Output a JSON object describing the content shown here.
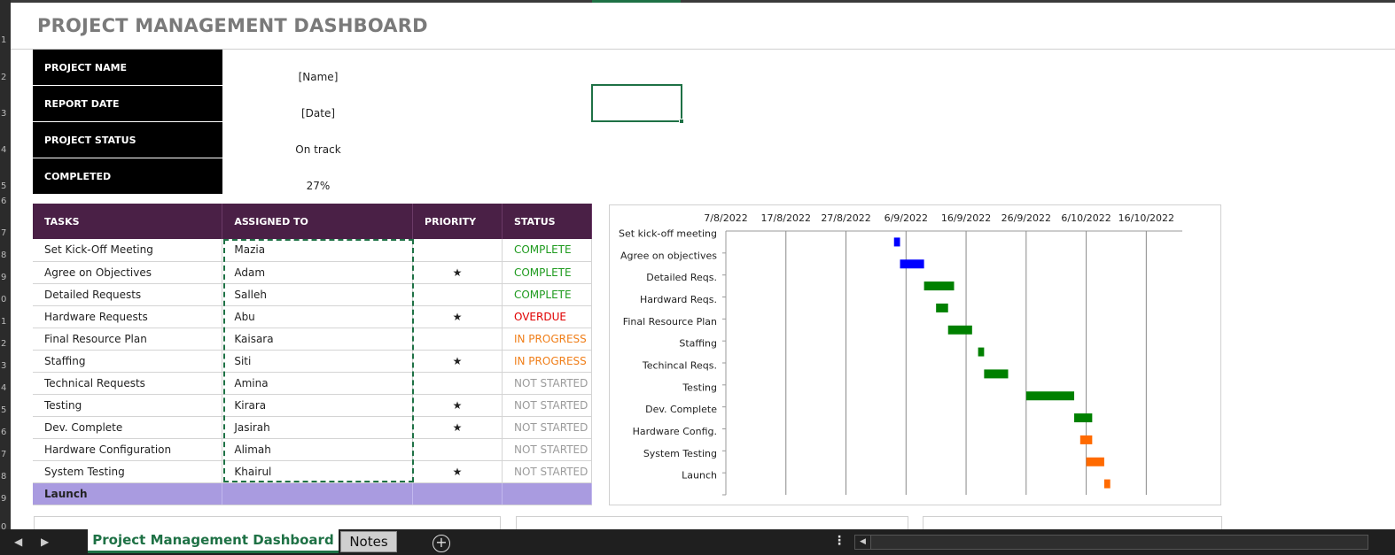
{
  "window": {
    "title": "PROJECT MANAGEMENT DASHBOARD"
  },
  "row_numbers": [
    "1",
    "2",
    "3",
    "4",
    "5",
    "6",
    "7",
    "8",
    "9",
    "0",
    "1",
    "2",
    "3",
    "4",
    "5",
    "6",
    "7",
    "8",
    "9",
    "0"
  ],
  "project_info": [
    {
      "label": "PROJECT NAME",
      "value": "[Name]"
    },
    {
      "label": "REPORT DATE",
      "value": "[Date]"
    },
    {
      "label": "PROJECT STATUS",
      "value": "On track"
    },
    {
      "label": "COMPLETED",
      "value": "27%"
    }
  ],
  "task_table": {
    "headers": [
      "TASKS",
      "ASSIGNED TO",
      "PRIORITY",
      "STATUS"
    ],
    "rows": [
      {
        "task": "Set Kick-Off Meeting",
        "assigned": "Mazia",
        "priority": "",
        "status": "COMPLETE",
        "status_kind": "complete"
      },
      {
        "task": "Agree on Objectives",
        "assigned": "Adam",
        "priority": "★",
        "status": "COMPLETE",
        "status_kind": "complete"
      },
      {
        "task": "Detailed Requests",
        "assigned": "Salleh",
        "priority": "",
        "status": "COMPLETE",
        "status_kind": "complete"
      },
      {
        "task": "Hardware Requests",
        "assigned": "Abu",
        "priority": "★",
        "status": "OVERDUE",
        "status_kind": "overdue"
      },
      {
        "task": "Final Resource Plan",
        "assigned": "Kaisara",
        "priority": "",
        "status": "IN PROGRESS",
        "status_kind": "progress"
      },
      {
        "task": "Staffing",
        "assigned": "Siti",
        "priority": "★",
        "status": "IN PROGRESS",
        "status_kind": "progress"
      },
      {
        "task": "Technical Requests",
        "assigned": "Amina",
        "priority": "",
        "status": "NOT STARTED",
        "status_kind": "notstarted"
      },
      {
        "task": "Testing",
        "assigned": "Kirara",
        "priority": "★",
        "status": "NOT STARTED",
        "status_kind": "notstarted"
      },
      {
        "task": "Dev. Complete",
        "assigned": "Jasirah",
        "priority": "★",
        "status": "NOT STARTED",
        "status_kind": "notstarted"
      },
      {
        "task": "Hardware Configuration",
        "assigned": "Alimah",
        "priority": "",
        "status": "NOT STARTED",
        "status_kind": "notstarted"
      },
      {
        "task": "System Testing",
        "assigned": "Khairul",
        "priority": "★",
        "status": "NOT STARTED",
        "status_kind": "notstarted"
      }
    ],
    "launch_row": {
      "task": "Launch"
    }
  },
  "colors": {
    "header_purple": "#4a2046",
    "launch_lavender": "#a99be0",
    "complete": "#1e9a1e",
    "overdue": "#e00000",
    "in_progress": "#f07f1a",
    "not_started": "#9b9b9b",
    "excel_green": "#1e7145"
  },
  "chart_data": {
    "type": "bar",
    "orientation": "horizontal-gantt",
    "x_axis_ticks": [
      "7/8/2022",
      "17/8/2022",
      "27/8/2022",
      "6/9/2022",
      "16/9/2022",
      "26/9/2022",
      "6/10/2022",
      "16/10/2022"
    ],
    "xlim": [
      "2022-08-07",
      "2022-10-22"
    ],
    "grid": true,
    "categories": [
      "Set kick-off meeting",
      "Agree on objectives",
      "Detailed Reqs.",
      "Hardward Reqs.",
      "Final Resource Plan",
      "Staffing",
      "Techincal Reqs.",
      "Testing",
      "Dev. Complete",
      "Hardware Config.",
      "System Testing",
      "Launch"
    ],
    "series": [
      {
        "values": [
          {
            "start": "2022-09-04",
            "end": "2022-09-05",
            "color": "#0000ff"
          },
          {
            "start": "2022-09-05",
            "end": "2022-09-09",
            "color": "#0000ff"
          },
          {
            "start": "2022-09-09",
            "end": "2022-09-14",
            "color": "#008000"
          },
          {
            "start": "2022-09-11",
            "end": "2022-09-13",
            "color": "#008000"
          },
          {
            "start": "2022-09-13",
            "end": "2022-09-17",
            "color": "#008000"
          },
          {
            "start": "2022-09-18",
            "end": "2022-09-19",
            "color": "#008000"
          },
          {
            "start": "2022-09-19",
            "end": "2022-09-23",
            "color": "#008000"
          },
          {
            "start": "2022-09-26",
            "end": "2022-10-04",
            "color": "#008000"
          },
          {
            "start": "2022-10-04",
            "end": "2022-10-07",
            "color": "#008000"
          },
          {
            "start": "2022-10-05",
            "end": "2022-10-07",
            "color": "#ff6a00"
          },
          {
            "start": "2022-10-06",
            "end": "2022-10-09",
            "color": "#ff6a00"
          },
          {
            "start": "2022-10-09",
            "end": "2022-10-10",
            "color": "#ff6a00"
          }
        ]
      }
    ]
  },
  "sheet_tabs": {
    "active": "Project Management Dashboard",
    "other": "Notes",
    "add_symbol": "+",
    "nav_prev": "◀",
    "nav_next": "▶",
    "menu_dots": "⋮",
    "scroll_left": "◀"
  }
}
